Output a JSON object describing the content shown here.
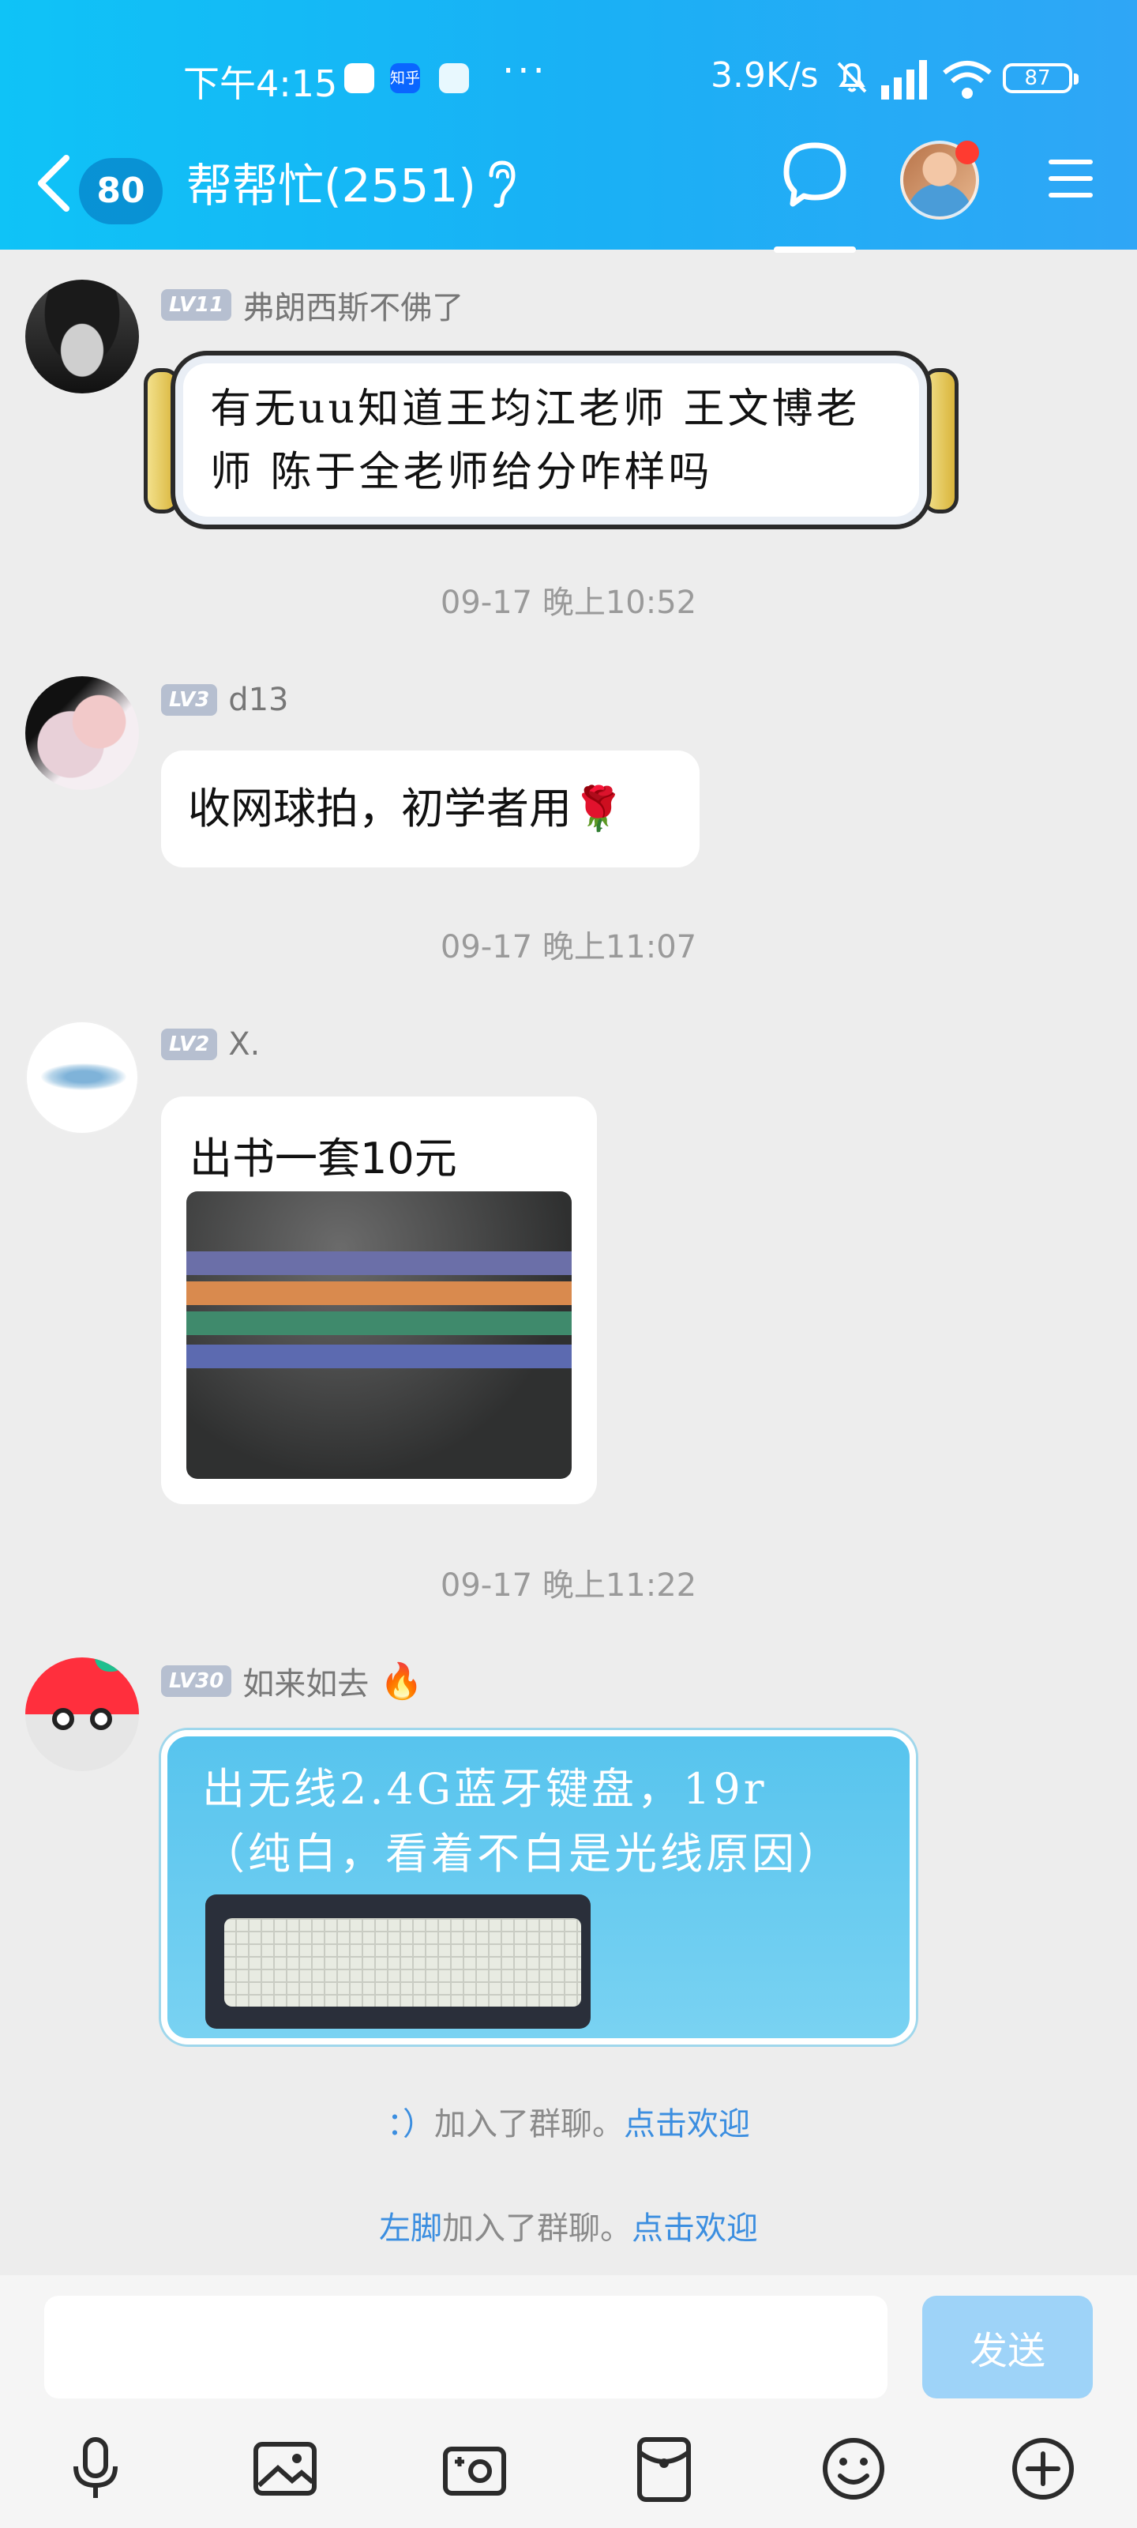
{
  "status": {
    "time": "下午4:15",
    "zhihu": "知乎",
    "more": "···",
    "speed": "3.9K/s",
    "battery": "87"
  },
  "header": {
    "unread": "80",
    "title": "帮帮忙(2551)"
  },
  "messages": [
    {
      "level": "LV11",
      "sender": "弗朗西斯不佛了",
      "text_line1": "有无uu知道王均江老师 王文博老",
      "text_line2": "师 陈于全老师给分咋样吗"
    },
    {
      "timestamp": "09-17 晚上10:52"
    },
    {
      "level": "LV3",
      "sender": "d13",
      "text": "收网球拍，初学者用",
      "emoji": "🌹"
    },
    {
      "timestamp": "09-17 晚上11:07"
    },
    {
      "level": "LV2",
      "sender": "X.",
      "text": "出书一套10元"
    },
    {
      "timestamp": "09-17 晚上11:22"
    },
    {
      "level": "LV30",
      "sender": "如来如去",
      "badge": "🔥",
      "text_line1": "出无线2.4G蓝牙键盘，19r",
      "text_line2": "（纯白，看着不白是光线原因）"
    }
  ],
  "system": [
    {
      "name": "：）",
      "action": "加入了群聊。",
      "link": "点击欢迎"
    },
    {
      "name": "左脚",
      "action": "加入了群聊。",
      "link": "点击欢迎"
    }
  ],
  "input": {
    "value": "",
    "send_label": "发送"
  },
  "colors": {
    "header": "#19b1f5",
    "send": "#9ed3f8",
    "link": "#3b8ee0"
  }
}
